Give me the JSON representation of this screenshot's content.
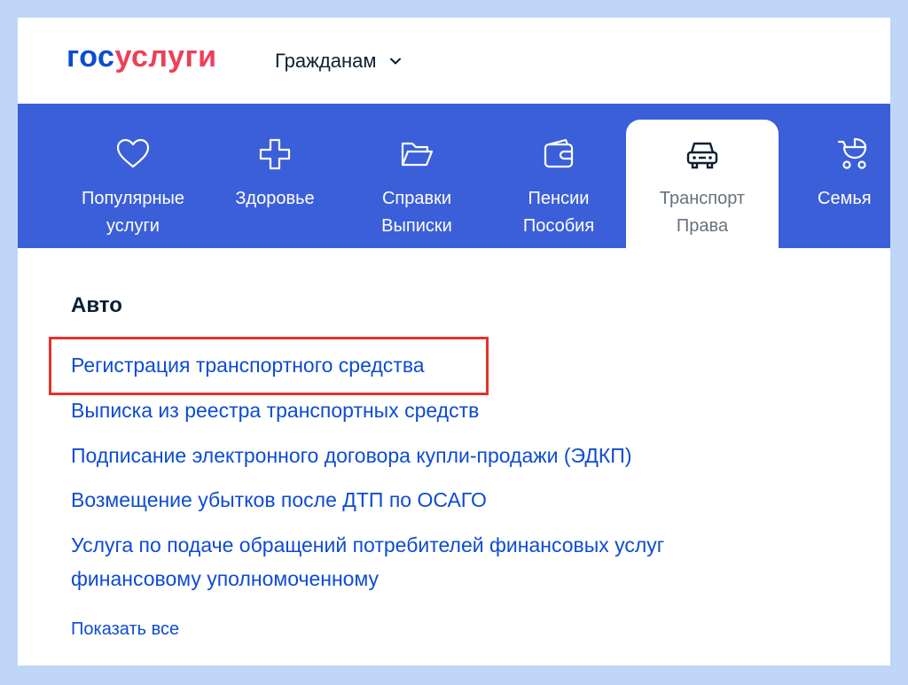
{
  "header": {
    "logo_part1": "гос",
    "logo_part2": "услуги",
    "menu_label": "Гражданам"
  },
  "nav": {
    "tabs": [
      {
        "line1": "Популярные",
        "line2": "услуги",
        "icon": "heart-icon"
      },
      {
        "line1": "Здоровье",
        "line2": "",
        "icon": "medical-cross-icon"
      },
      {
        "line1": "Справки",
        "line2": "Выписки",
        "icon": "folder-icon"
      },
      {
        "line1": "Пенсии",
        "line2": "Пособия",
        "icon": "wallet-icon"
      },
      {
        "line1": "Транспорт",
        "line2": "Права",
        "icon": "car-icon",
        "active": true
      },
      {
        "line1": "Семья",
        "line2": "",
        "icon": "stroller-icon"
      }
    ]
  },
  "section": {
    "title": "Авто",
    "links": [
      "Регистрация транспортного средства",
      "Выписка из реестра транспортных средств",
      "Подписание электронного договора купли-продажи (ЭДКП)",
      "Возмещение убытков после ДТП по ОСАГО",
      "Услуга по подаче обращений потребителей финансовых услуг",
      "финансовому уполномоченному"
    ],
    "show_all": "Показать все"
  },
  "colors": {
    "navbar": "#3b5fd9",
    "link": "#0d4cd3",
    "logo_blue": "#0d4cd3",
    "logo_red": "#ee3f58",
    "highlight": "#e5332a",
    "frame_bg": "#bfd6f7"
  }
}
